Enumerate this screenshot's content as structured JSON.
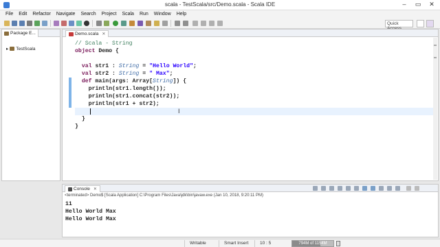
{
  "window": {
    "title": "scala - TestScala/src/Demo.scala - Scala IDE",
    "controls": [
      "–",
      "▭",
      "✕"
    ]
  },
  "menubar": [
    "File",
    "Edit",
    "Refactor",
    "Navigate",
    "Search",
    "Project",
    "Scala",
    "Run",
    "Window",
    "Help"
  ],
  "toolbar": {
    "quick_access": "Quick Access"
  },
  "package_explorer": {
    "tab_label": "Package E...",
    "items": [
      {
        "label": "TestScala",
        "expand": "▸"
      }
    ]
  },
  "editor": {
    "tab_label": "Demo.scala",
    "tab_close": "✕"
  },
  "console": {
    "tab_label": "Console",
    "tab_close": "✕",
    "terminated_line": "<terminated> Demo$ [Scala Application] C:\\Program Files\\Java\\jdk\\bin\\javaw.exe (Jan 10, 2018, 9:20:11 PM)",
    "output": [
      "11",
      "Hello World Max",
      "Hello World Max"
    ]
  },
  "statusbar": {
    "writable": "Writable",
    "insert_mode": "Smart Insert",
    "position": "10 : 5",
    "heap": "794M of 1154M",
    "heap_used_fraction": 0.69
  },
  "colors": {
    "keyword": "#7a1a5a",
    "type": "#3d6aa5",
    "string": "#2a00ff",
    "comment": "#3f7f5f"
  }
}
